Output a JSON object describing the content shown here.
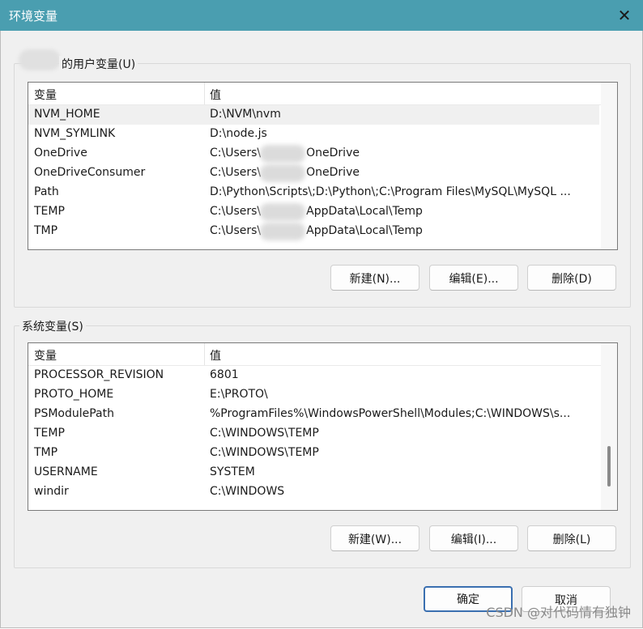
{
  "window": {
    "title": "环境变量",
    "close_glyph": "✕"
  },
  "user_group": {
    "label": "的用户变量(U)",
    "headers": {
      "variable": "变量",
      "value": "值"
    },
    "rows": [
      {
        "name": "NVM_HOME",
        "value_pre": "D:\\NVM\\nvm",
        "value_post": "",
        "redacted": false,
        "selected": true
      },
      {
        "name": "NVM_SYMLINK",
        "value_pre": "D:\\node.js",
        "value_post": "",
        "redacted": false,
        "selected": false
      },
      {
        "name": "OneDrive",
        "value_pre": "C:\\Users\\",
        "value_post": "OneDrive",
        "redacted": true,
        "selected": false
      },
      {
        "name": "OneDriveConsumer",
        "value_pre": "C:\\Users\\",
        "value_post": "OneDrive",
        "redacted": true,
        "selected": false
      },
      {
        "name": "Path",
        "value_pre": "D:\\Python\\Scripts\\;D:\\Python\\;C:\\Program Files\\MySQL\\MySQL ...",
        "value_post": "",
        "redacted": false,
        "selected": false
      },
      {
        "name": "TEMP",
        "value_pre": "C:\\Users\\",
        "value_post": "AppData\\Local\\Temp",
        "redacted": true,
        "selected": false
      },
      {
        "name": "TMP",
        "value_pre": "C:\\Users\\",
        "value_post": "AppData\\Local\\Temp",
        "redacted": true,
        "selected": false
      }
    ],
    "buttons": {
      "new": "新建(N)...",
      "edit": "编辑(E)...",
      "delete": "删除(D)"
    }
  },
  "system_group": {
    "label": "系统变量(S)",
    "headers": {
      "variable": "变量",
      "value": "值"
    },
    "rows": [
      {
        "name": "PROCESSOR_REVISION",
        "value": "6801"
      },
      {
        "name": "PROTO_HOME",
        "value": "E:\\PROTO\\"
      },
      {
        "name": "PSModulePath",
        "value": "%ProgramFiles%\\WindowsPowerShell\\Modules;C:\\WINDOWS\\s..."
      },
      {
        "name": "TEMP",
        "value": "C:\\WINDOWS\\TEMP"
      },
      {
        "name": "TMP",
        "value": "C:\\WINDOWS\\TEMP"
      },
      {
        "name": "USERNAME",
        "value": "SYSTEM"
      },
      {
        "name": "windir",
        "value": "C:\\WINDOWS"
      }
    ],
    "scroll_fraction": 0.85,
    "buttons": {
      "new": "新建(W)...",
      "edit": "编辑(I)...",
      "delete": "删除(L)"
    }
  },
  "footer": {
    "ok": "确定",
    "cancel": "取消"
  },
  "watermark": "CSDN @对代码情有独钟"
}
